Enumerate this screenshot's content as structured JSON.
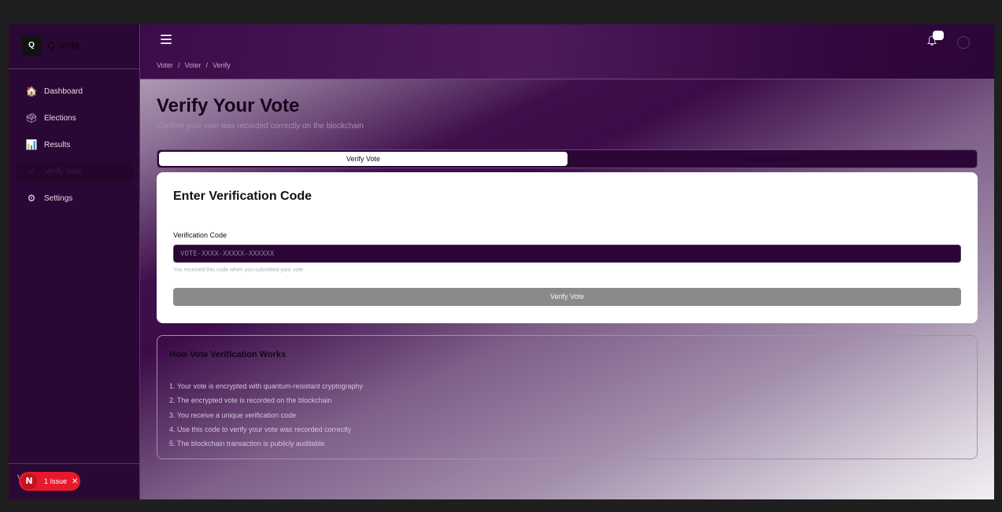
{
  "brand": {
    "logo_letter": "Q",
    "name": "Q-Vote"
  },
  "sidebar": {
    "items": [
      {
        "label": "Dashboard",
        "icon": "house-icon",
        "glyph": "🏠"
      },
      {
        "label": "Elections",
        "icon": "ballot-box-icon",
        "glyph": "🗳"
      },
      {
        "label": "Results",
        "icon": "bar-chart-icon",
        "glyph": "📊"
      },
      {
        "label": "Verify Vote",
        "icon": "check-icon",
        "glyph": "✓"
      },
      {
        "label": "Settings",
        "icon": "gear-icon",
        "glyph": "⚙"
      }
    ],
    "footer_letter": "V"
  },
  "issue_badge": {
    "letter": "N",
    "text": "1 Issue",
    "close": "✕"
  },
  "header": {
    "menu_icon": "hamburger-icon",
    "breadcrumb": [
      "Voter",
      "/",
      "Voter",
      "/",
      "Verify"
    ],
    "bell_icon": "bell-icon"
  },
  "page": {
    "title": "Verify Your Vote",
    "subtitle": "Confirm your vote was recorded correctly on the blockchain"
  },
  "tabs": {
    "active": "Verify Vote",
    "inactive": "Transparency Info"
  },
  "form": {
    "title": "Enter Verification Code",
    "label": "Verification Code",
    "placeholder": "VOTE-XXXX-XXXXX-XXXXXX",
    "helper": "You received this code when you submitted your vote",
    "button": "Verify Vote"
  },
  "howto": {
    "title": "How Vote Verification Works",
    "steps": [
      "1. Your vote is encrypted with quantum-resistant cryptography",
      "2. The encrypted vote is recorded on the blockchain",
      "3. You receive a unique verification code",
      "4. Use this code to verify your vote was recorded correctly",
      "5. The blockchain transaction is publicly auditable"
    ]
  },
  "colors": {
    "sidebar_bg": "#2a0835",
    "accent": "#3c0b49",
    "issue": "#e8192c"
  }
}
